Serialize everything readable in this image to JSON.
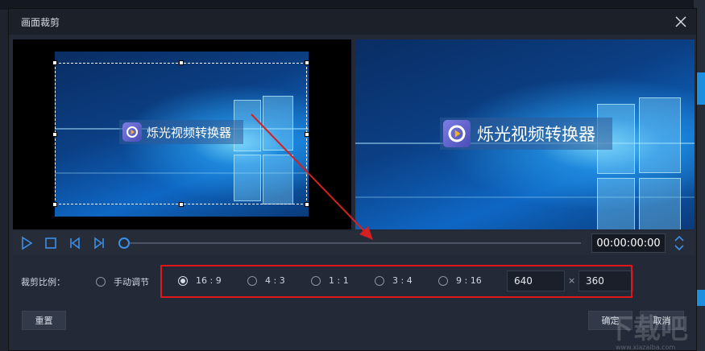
{
  "dialog": {
    "title": "画面裁剪",
    "close_icon": "close-icon"
  },
  "preview": {
    "logo_text": "烁光视频转换器",
    "logo_icon": "play-circle-icon"
  },
  "player": {
    "time": "00:00:00:00",
    "progress": 0
  },
  "crop_ratio": {
    "label": "裁剪比例：",
    "options": [
      {
        "label": "手动调节",
        "selected": false
      },
      {
        "label": "16 : 9",
        "selected": true
      },
      {
        "label": "4 : 3",
        "selected": false
      },
      {
        "label": "1 : 1",
        "selected": false
      },
      {
        "label": "3 : 4",
        "selected": false
      },
      {
        "label": "9 : 16",
        "selected": false
      }
    ],
    "width_value": "640",
    "times_symbol": "×",
    "height_value": "360"
  },
  "buttons": {
    "reset": "重置",
    "confirm": "确定",
    "cancel": "取消"
  },
  "colors": {
    "accent": "#3d8fe8",
    "highlight_border": "#e0161a",
    "annotation_arrow": "#d42020"
  }
}
